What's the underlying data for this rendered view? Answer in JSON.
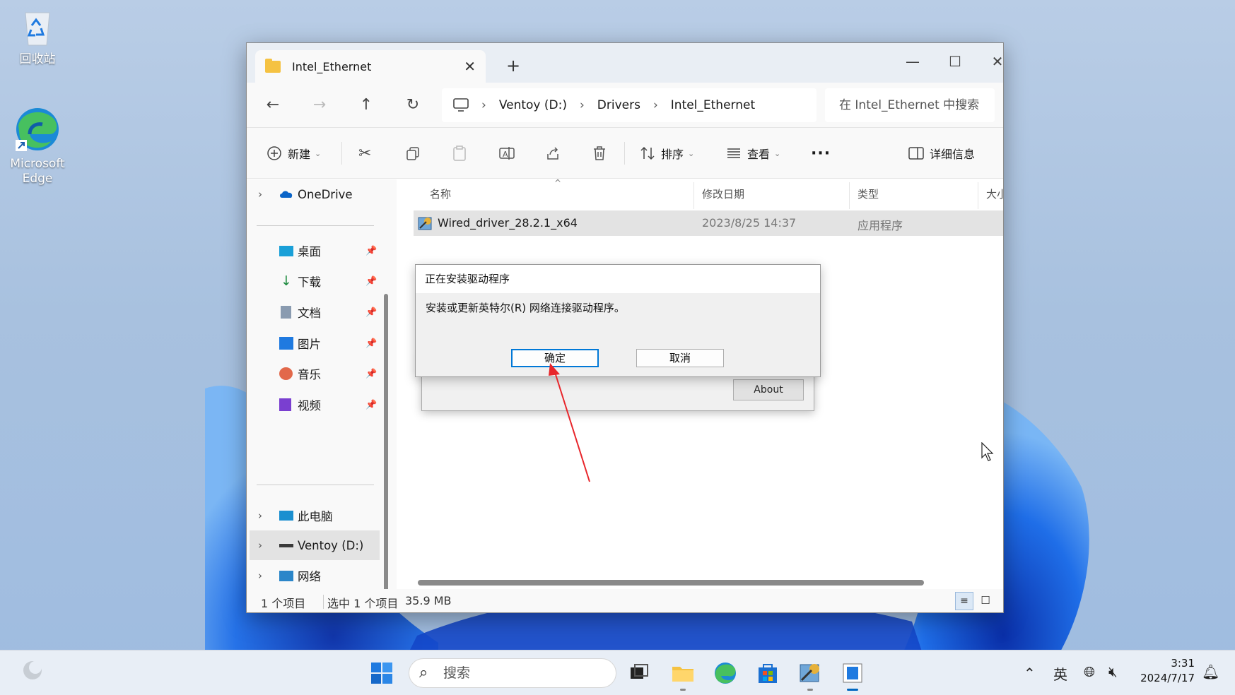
{
  "desktop": {
    "icons": [
      {
        "label": "回收站",
        "name": "recycle-bin"
      },
      {
        "label": "Microsoft Edge",
        "name": "microsoft-edge"
      }
    ]
  },
  "explorer": {
    "tab_title": "Intel_Ethernet",
    "breadcrumb": [
      "Ventoy (D:)",
      "Drivers",
      "Intel_Ethernet"
    ],
    "search_placeholder": "在 Intel_Ethernet 中搜索",
    "toolbar": {
      "new_label": "新建",
      "sort_label": "排序",
      "view_label": "查看",
      "more_label": "···",
      "details_label": "详细信息"
    },
    "sidebar": {
      "onedrive": "OneDrive",
      "quick": [
        {
          "label": "桌面",
          "icon": "desktop-icon"
        },
        {
          "label": "下载",
          "icon": "download-icon"
        },
        {
          "label": "文档",
          "icon": "documents-icon"
        },
        {
          "label": "图片",
          "icon": "pictures-icon"
        },
        {
          "label": "音乐",
          "icon": "music-icon"
        },
        {
          "label": "视频",
          "icon": "videos-icon"
        }
      ],
      "this_pc": "此电脑",
      "drive": "Ventoy (D:)",
      "network": "网络"
    },
    "columns": {
      "name": "名称",
      "modified": "修改日期",
      "type": "类型",
      "size": "大小"
    },
    "files": [
      {
        "name": "Wired_driver_28.2.1_x64",
        "modified": "2023/8/25 14:37",
        "type": "应用程序"
      }
    ],
    "status": {
      "count": "1 个项目",
      "selected": "选中 1 个项目",
      "size": "35.9 MB"
    }
  },
  "installer": {
    "about_label": "About",
    "dialog": {
      "title": "正在安装驱动程序",
      "message": "安装或更新英特尔(R) 网络连接驱动程序。",
      "ok_label": "确定",
      "cancel_label": "取消"
    }
  },
  "taskbar": {
    "search_placeholder": "搜索",
    "ime": "英",
    "time": "3:31",
    "date": "2024/7/17"
  },
  "colors": {
    "accent": "#0078d7",
    "annotation_arrow": "#e8262b"
  }
}
